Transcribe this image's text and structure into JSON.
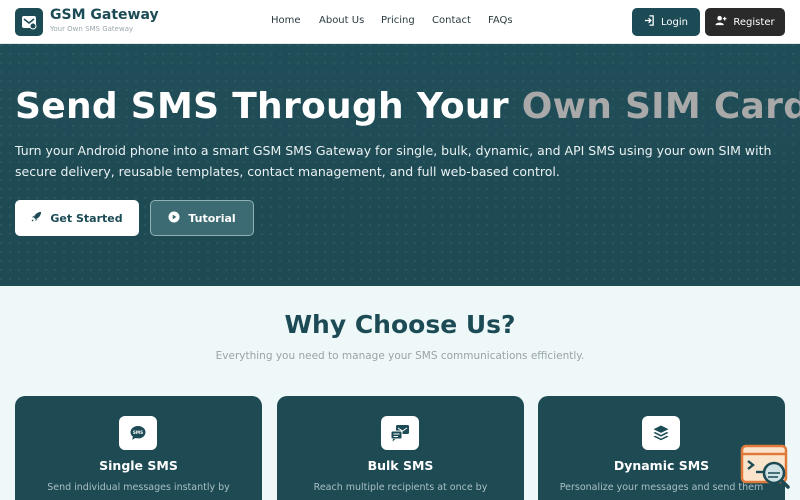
{
  "brand": {
    "name": "GSM Gateway",
    "tagline": "Your Own SMS Gateway"
  },
  "nav": {
    "links": [
      "Home",
      "About Us",
      "Pricing",
      "Contact",
      "FAQs"
    ],
    "login_label": "Login",
    "register_label": "Register"
  },
  "hero": {
    "title_main": "Send SMS Through Your ",
    "title_highlight": "Own SIM Card",
    "subtitle": "Turn your Android phone into a smart GSM SMS Gateway for single, bulk, dynamic, and API SMS using your own SIM with secure delivery, reusable templates, contact management, and full web-based control.",
    "get_started_label": "Get Started",
    "tutorial_label": "Tutorial"
  },
  "why": {
    "title": "Why Choose Us?",
    "subtitle": "Everything you need to manage your SMS communications efficiently.",
    "cards": [
      {
        "title": "Single SMS",
        "text": "Send individual messages instantly by",
        "icon": "sms-bubble-icon"
      },
      {
        "title": "Bulk SMS",
        "text": "Reach multiple recipients at once by",
        "icon": "bulk-sms-icon"
      },
      {
        "title": "Dynamic SMS",
        "text": "Personalize your messages and send them",
        "icon": "layers-icon"
      }
    ]
  },
  "colors": {
    "primary": "#1c4b55",
    "dark_button": "#2a2a2a",
    "page_bg": "#eef8f8",
    "widget_accent": "#e07a3a"
  }
}
